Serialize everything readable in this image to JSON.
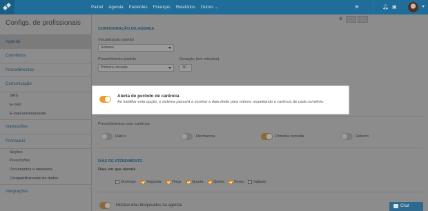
{
  "navbar": {
    "links": [
      "Painel",
      "Agenda",
      "Pacientes",
      "Finanças",
      "Relatórios",
      "Outros"
    ],
    "icons": [
      "plus-circle-icon",
      "bell-icon",
      "help-icon"
    ]
  },
  "sidebar": {
    "title": "Configs. de profissionais",
    "items": [
      {
        "label": "Agenda"
      },
      {
        "label": "Convênios"
      },
      {
        "label": "Procedimentos"
      },
      {
        "label": "Comunicação"
      },
      {
        "label": "Impressões"
      },
      {
        "label": "Prontuário"
      },
      {
        "label": "Integrações"
      }
    ],
    "comunicacao_sub": [
      "SMS",
      "E-mail",
      "E-mail aniversariante"
    ],
    "prontuario_sub": [
      "Seções",
      "Prescrições",
      "Documentos e atestados",
      "Compartilhamento de dados"
    ]
  },
  "agenda": {
    "section_title": "CONFIGURAÇÃO DA AGENDA",
    "view_label": "Visualização padrão",
    "view_value": "Semana",
    "proc_label": "Procedimento padrão",
    "proc_value": "Primeira consulta",
    "duration_label": "Duração (em minutos)",
    "duration_value": "30"
  },
  "alert": {
    "title": "Alerta de período de carência",
    "description": "Ao habilitar esta opção, o sistema passará a mostrar a data limite para retorno respeitando a carência de cada convênio.",
    "enabled": true
  },
  "carencia": {
    "label": "Procedimentos com carência",
    "items": [
      {
        "label": "Raio x",
        "on": false
      },
      {
        "label": "Desmarcou",
        "on": false
      },
      {
        "label": "Primeira consulta",
        "on": true
      },
      {
        "label": "Retorno",
        "on": false
      }
    ]
  },
  "dias": {
    "section_title": "DIAS DE ATENDIMENTO",
    "label": "Dias em que atende",
    "days": [
      {
        "label": "Domingo",
        "checked": false
      },
      {
        "label": "Segunda",
        "checked": true
      },
      {
        "label": "Terça",
        "checked": true
      },
      {
        "label": "Quarta",
        "checked": true
      },
      {
        "label": "Quinta",
        "checked": true
      },
      {
        "label": "Sexta",
        "checked": true
      },
      {
        "label": "Sábado",
        "checked": false
      }
    ]
  },
  "blocked": {
    "label": "Mostrar dias bloqueados na agenda",
    "enabled": true
  },
  "chat": {
    "label": "Chat"
  },
  "colors": {
    "navbar": "#1f6d98",
    "accent": "#f39a2e",
    "link": "#21506f"
  }
}
